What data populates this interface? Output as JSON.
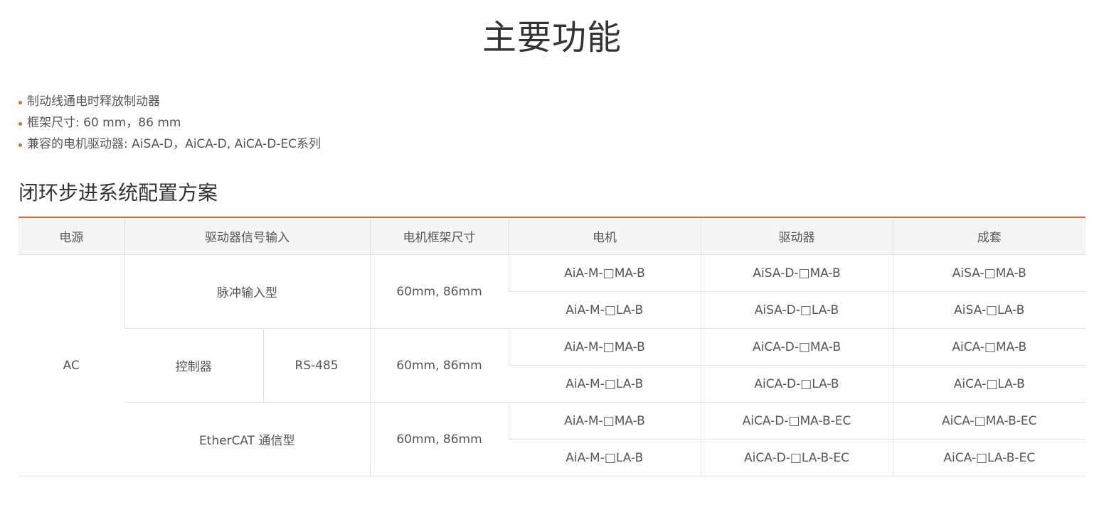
{
  "title": "主要功能",
  "features": [
    "制动线通电时释放制动器",
    "框架尺寸: 60 mm，86 mm",
    "兼容的电机驱动器: AiSA-D，AiCA-D, AiCA-D-EC系列"
  ],
  "section_title": "闭环步进系统配置方案",
  "table": {
    "headers": [
      "电源",
      "驱动器信号输入",
      "电机框架尺寸",
      "电机",
      "驱动器",
      "成套"
    ],
    "power": "AC",
    "groups": [
      {
        "input": "脉冲输入型",
        "frame": "60mm, 86mm",
        "rows": [
          {
            "motor": "AiA-M-□MA-B",
            "driver": "AiSA-D-□MA-B",
            "set": "AiSA-□MA-B"
          },
          {
            "motor": "AiA-M-□LA-B",
            "driver": "AiSA-D-□LA-B",
            "set": "AiSA-□LA-B"
          }
        ]
      },
      {
        "input": "控制器",
        "input_sub": "RS-485",
        "frame": "60mm, 86mm",
        "rows": [
          {
            "motor": "AiA-M-□MA-B",
            "driver": "AiCA-D-□MA-B",
            "set": "AiCA-□MA-B"
          },
          {
            "motor": "AiA-M-□LA-B",
            "driver": "AiCA-D-□LA-B",
            "set": "AiCA-□LA-B"
          }
        ]
      },
      {
        "input": "EtherCAT 通信型",
        "frame": "60mm, 86mm",
        "rows": [
          {
            "motor": "AiA-M-□MA-B",
            "driver": "AiCA-D-□MA-B-EC",
            "set": "AiCA-□MA-B-EC"
          },
          {
            "motor": "AiA-M-□LA-B",
            "driver": "AiCA-D-□LA-B-EC",
            "set": "AiCA-□LA-B-EC"
          }
        ]
      }
    ]
  },
  "colors": {
    "accent": "#e8692c",
    "header_bg": "#f5f5f5",
    "border": "#e3e3e3",
    "text": "#555555"
  }
}
